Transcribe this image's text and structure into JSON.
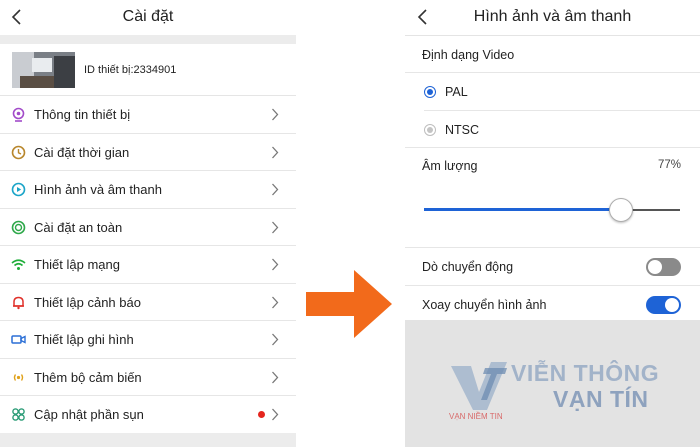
{
  "left": {
    "title": "Cài đặt",
    "device_id": "ID thiết bị:2334901",
    "menu": [
      {
        "label": "Thông tin thiết bị",
        "icon": "device-info-icon",
        "color": "#a24bc9"
      },
      {
        "label": "Cài đặt thời gian",
        "icon": "clock-icon",
        "color": "#b8862b"
      },
      {
        "label": "Hình ảnh và âm thanh",
        "icon": "media-icon",
        "color": "#1aa4c8"
      },
      {
        "label": "Cài đặt an toàn",
        "icon": "security-icon",
        "color": "#2ea84a"
      },
      {
        "label": "Thiết lập mạng",
        "icon": "wifi-icon",
        "color": "#1fae3a"
      },
      {
        "label": "Thiết lập cảnh báo",
        "icon": "bell-icon",
        "color": "#e0302a"
      },
      {
        "label": "Thiết lập ghi hình",
        "icon": "video-record-icon",
        "color": "#2b6fd6"
      },
      {
        "label": "Thêm bộ cảm biến",
        "icon": "sensor-icon",
        "color": "#e0a21b"
      },
      {
        "label": "Cập nhật phần sụn",
        "icon": "firmware-icon",
        "color": "#2d9d78",
        "badge": true
      }
    ]
  },
  "right": {
    "title": "Hình ảnh và âm thanh",
    "video_format_label": "Định dạng Video",
    "options": [
      {
        "label": "PAL",
        "selected": true
      },
      {
        "label": "NTSC",
        "selected": false
      }
    ],
    "volume_label": "Âm lượng",
    "volume_value": "77%",
    "volume_level": 0.77,
    "motion_detect_label": "Dò chuyển động",
    "motion_detect_on": false,
    "rotate_image_label": "Xoay chuyển hình ảnh",
    "rotate_image_on": true
  },
  "watermark": {
    "line1": "VIỄN THÔNG",
    "line2": "VẠN TÍN",
    "tagline": "VẠN NIỀM TIN"
  },
  "colors": {
    "accent": "#1e63d6",
    "arrow": "#f26a1b",
    "badge": "#e5261e"
  }
}
